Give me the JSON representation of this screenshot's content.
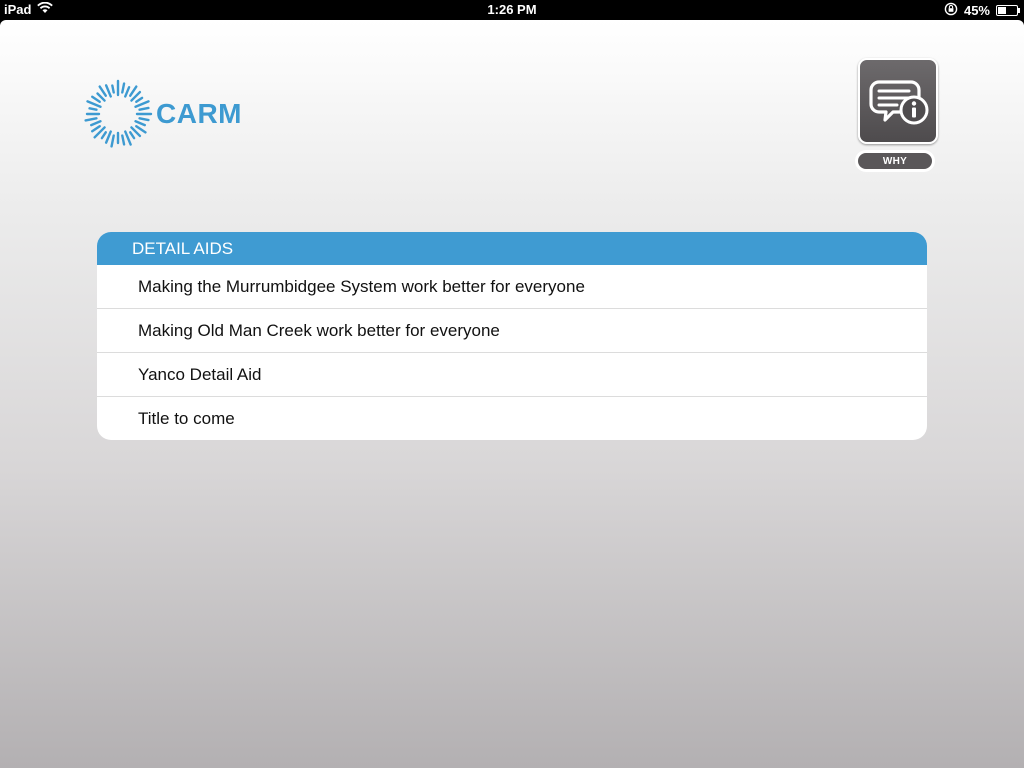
{
  "status_bar": {
    "device": "iPad",
    "time": "1:26 PM",
    "battery": "45%",
    "battery_level": 0.45,
    "icons": [
      "wifi-icon",
      "rotation-lock-icon",
      "battery-icon"
    ]
  },
  "logo": {
    "text": "CARM",
    "color": "#3d9ad1"
  },
  "why_button": {
    "label": "WHY",
    "icon": "chat-info-icon"
  },
  "detail_aids": {
    "header": "DETAIL AIDS",
    "header_color": "#3f9bd2",
    "items": [
      {
        "label": "Making the Murrumbidgee System work better for everyone"
      },
      {
        "label": "Making Old Man Creek work better for everyone"
      },
      {
        "label": "Yanco Detail Aid"
      },
      {
        "label": "Title to come"
      }
    ]
  }
}
